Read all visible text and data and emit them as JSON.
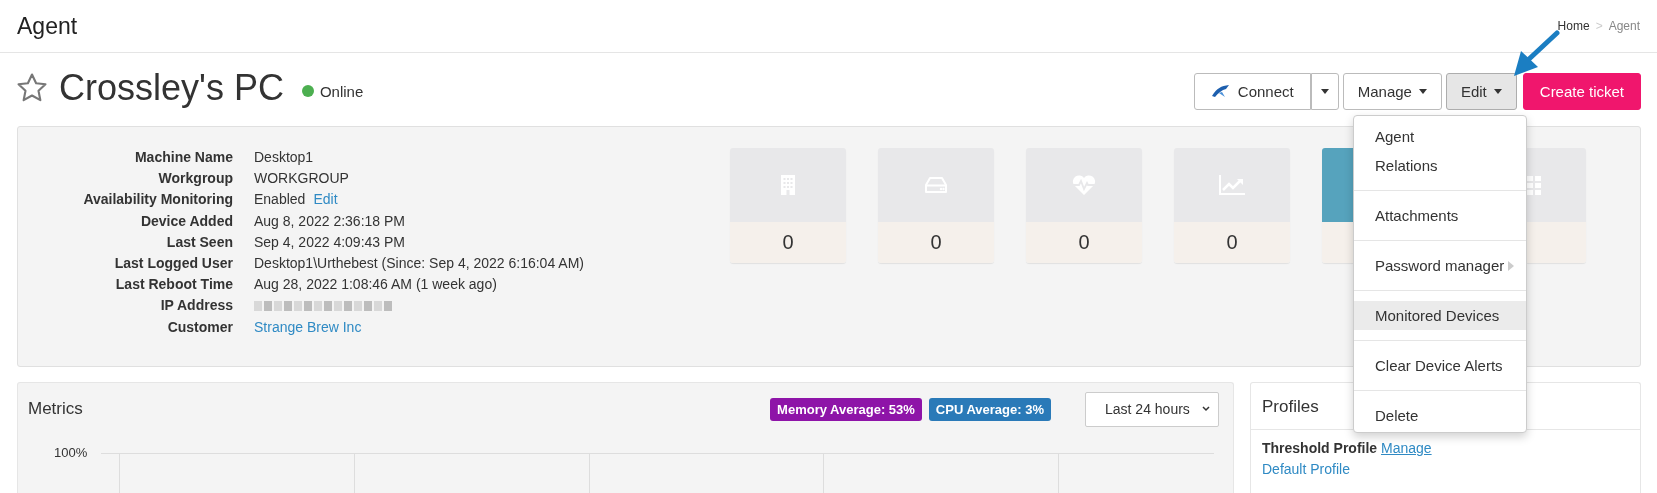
{
  "page": {
    "title": "Agent",
    "breadcrumb_separator": ">",
    "breadcrumb": [
      {
        "label": "Home",
        "selected": false
      },
      {
        "label": "Agent",
        "selected": true
      }
    ]
  },
  "device": {
    "name": "Crossley's PC",
    "favorite": false,
    "status": "Online",
    "online": true
  },
  "actions": [
    {
      "kind": "connect",
      "label": "Connect",
      "active": false
    },
    {
      "kind": "caret",
      "active": false
    },
    {
      "kind": "dropdown",
      "label": "Manage",
      "active": false
    },
    {
      "kind": "dropdown",
      "label": "Edit",
      "active": true
    },
    {
      "kind": "primary",
      "label": "Create ticket"
    }
  ],
  "edit_menu": [
    {
      "kind": "item",
      "label": "Agent",
      "highlighted": false,
      "submenu": false
    },
    {
      "kind": "item",
      "label": "Relations",
      "highlighted": false,
      "submenu": false
    },
    {
      "kind": "divider"
    },
    {
      "kind": "item",
      "label": "Attachments",
      "highlighted": false,
      "submenu": false
    },
    {
      "kind": "divider"
    },
    {
      "kind": "item",
      "label": "Password manager",
      "highlighted": false,
      "submenu": true
    },
    {
      "kind": "divider"
    },
    {
      "kind": "item",
      "label": "Monitored Devices",
      "highlighted": true,
      "submenu": false
    },
    {
      "kind": "divider"
    },
    {
      "kind": "item",
      "label": "Clear Device Alerts",
      "highlighted": false,
      "submenu": false
    },
    {
      "kind": "divider"
    },
    {
      "kind": "item",
      "label": "Delete",
      "highlighted": false,
      "submenu": false
    }
  ],
  "details": [
    {
      "kind": "text",
      "label": "Machine Name",
      "value": "Desktop1"
    },
    {
      "kind": "text",
      "label": "Workgroup",
      "value": "WORKGROUP"
    },
    {
      "kind": "text_action",
      "label": "Availability Monitoring",
      "value": "Enabled",
      "action": "Edit"
    },
    {
      "kind": "text",
      "label": "Device Added",
      "value": "Aug 8, 2022 2:36:18 PM"
    },
    {
      "kind": "text",
      "label": "Last Seen",
      "value": "Sep 4, 2022 4:09:43 PM"
    },
    {
      "kind": "text",
      "label": "Last Logged User",
      "value": "Desktop1\\Urthebest (Since: Sep 4, 2022 6:16:04 AM)"
    },
    {
      "kind": "text",
      "label": "Last Reboot Time",
      "value": "Aug 28, 2022 1:08:46 AM (1 week ago)"
    },
    {
      "kind": "redacted",
      "label": "IP Address"
    },
    {
      "kind": "link",
      "label": "Customer",
      "value": "Strange Brew Inc"
    }
  ],
  "tiles": [
    {
      "value": "0",
      "highlighted": false
    },
    {
      "value": "0",
      "highlighted": false
    },
    {
      "value": "0",
      "highlighted": false
    },
    {
      "value": "0",
      "highlighted": false
    },
    {
      "highlighted": true
    },
    {
      "highlighted": false
    }
  ],
  "metrics": {
    "title": "Metrics",
    "badges": [
      {
        "label": "Memory Average: 53%",
        "color": "#8e14a8"
      },
      {
        "label": "CPU Average: 3%",
        "color": "#2a7ab8"
      }
    ],
    "range": "Last 24 hours",
    "axis_label": "100%"
  },
  "profiles": {
    "title": "Profiles",
    "threshold_label": "Threshold Profile",
    "threshold_link": "Manage",
    "default_link": "Default Profile"
  }
}
